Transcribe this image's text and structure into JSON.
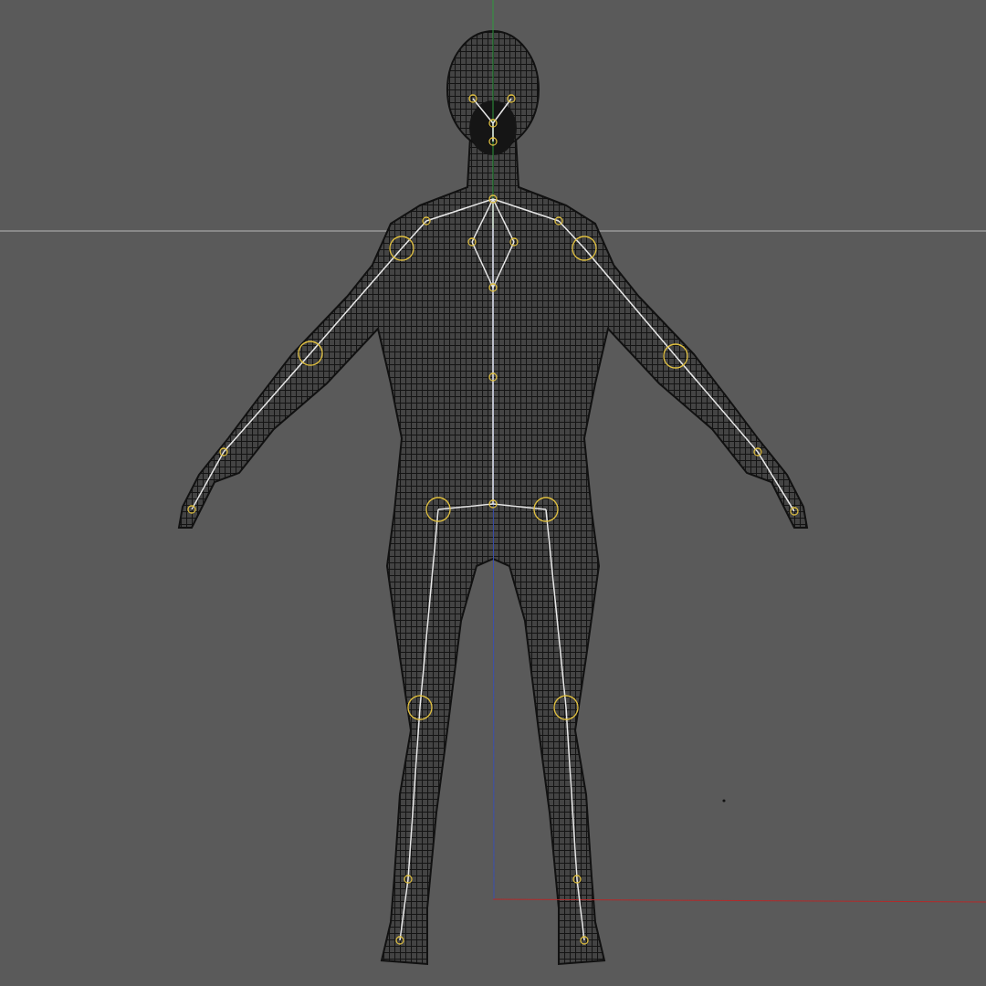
{
  "viewport": {
    "show_axes": true,
    "show_skeleton": true
  }
}
